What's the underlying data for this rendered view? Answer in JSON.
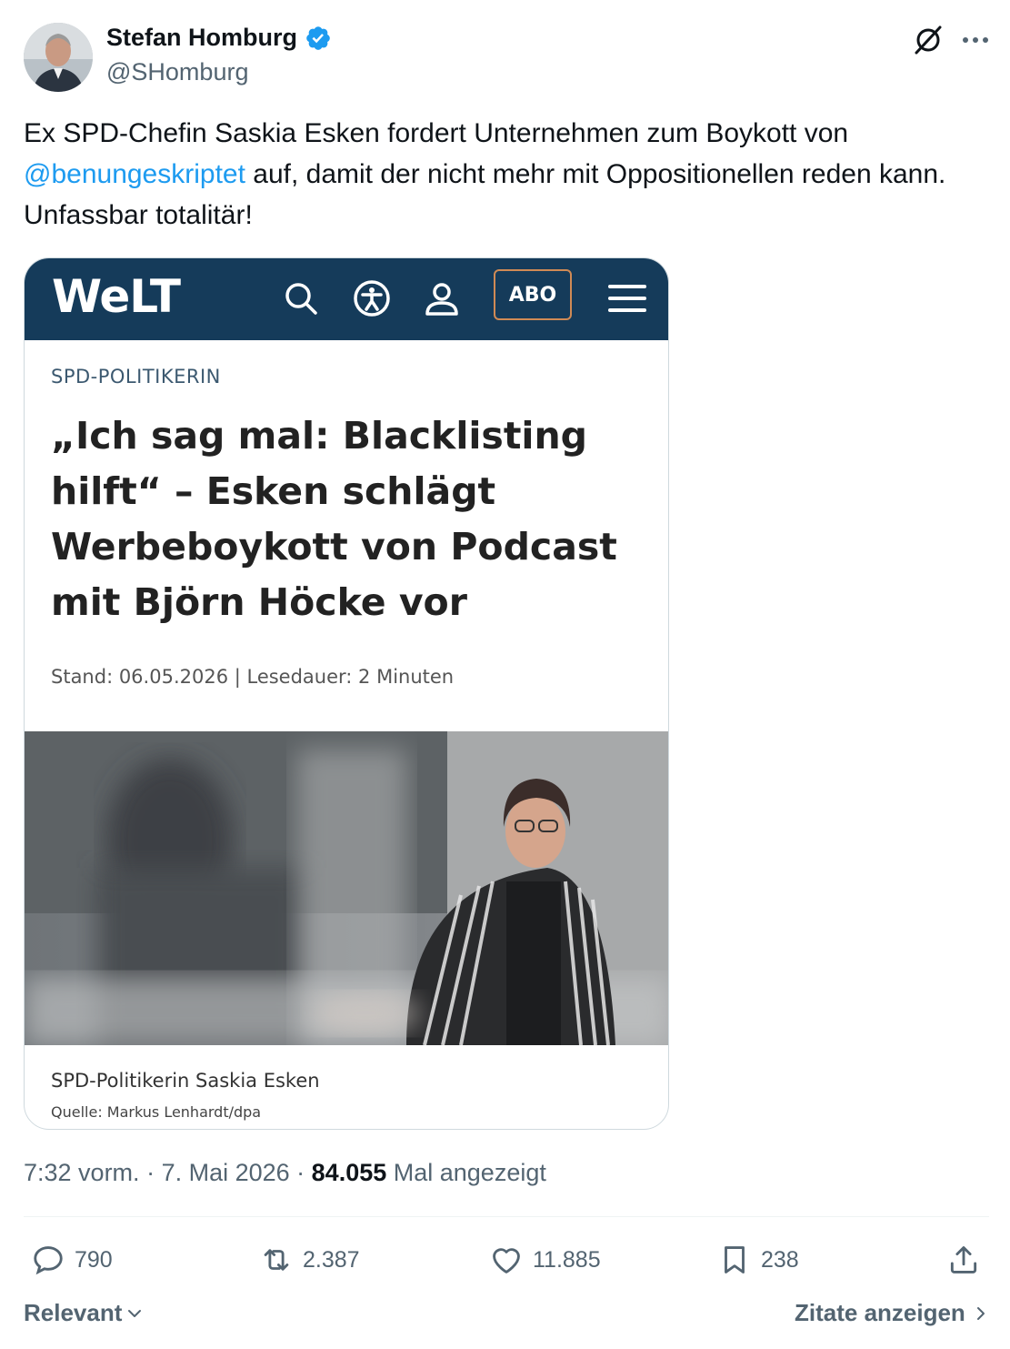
{
  "author": {
    "display_name": "Stefan Homburg",
    "handle": "@SHomburg",
    "verified": true
  },
  "tweet": {
    "text_before": "Ex SPD-Chefin Saskia Esken fordert Unternehmen zum Boykott von ",
    "mention": "@benungeskriptet",
    "text_after": " auf, damit der nicht mehr mit Oppositionellen reden kann. Unfassbar totalitär!"
  },
  "card": {
    "logo": "WeLT",
    "abo_label": "ABO",
    "kicker": "SPD-POLITIKERIN",
    "headline": "„Ich sag mal: Blacklisting hilft“ – Esken schlägt Werbeboykott von Podcast mit Björn Höcke vor",
    "meta": "Stand: 06.05.2026 | Lesedauer: 2 Minuten",
    "caption": "SPD-Politikerin Saskia Esken",
    "credit": "Quelle: Markus Lenhardt/dpa",
    "bar_color": "#153b5a"
  },
  "meta_line": {
    "time": "7:32 vorm.",
    "sep1": " · ",
    "date": "7. Mai 2026",
    "sep2": " · ",
    "views": "84.055",
    "views_label": " Mal angezeigt"
  },
  "actions": {
    "replies": "790",
    "reposts": "2.387",
    "likes": "11.885",
    "bookmarks": "238"
  },
  "footer": {
    "sort_label": "Relevant",
    "quotes_label": "Zitate anzeigen"
  },
  "colors": {
    "accent": "#1d9bf0",
    "muted": "#536471",
    "text": "#0f1419"
  }
}
